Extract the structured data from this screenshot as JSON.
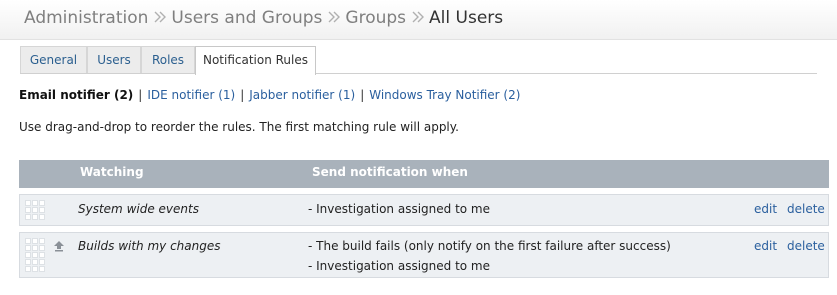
{
  "breadcrumb": {
    "items": [
      "Administration",
      "Users and Groups",
      "Groups"
    ],
    "current": "All Users"
  },
  "tabs": [
    {
      "label": "General",
      "active": false
    },
    {
      "label": "Users",
      "active": false
    },
    {
      "label": "Roles",
      "active": false
    },
    {
      "label": "Notification Rules",
      "active": true
    }
  ],
  "notifiers": {
    "current": "Email notifier (2)",
    "separator": "|",
    "links": [
      "IDE notifier (1)",
      "Jabber notifier (1)",
      "Windows Tray Notifier (2)"
    ]
  },
  "hint": "Use drag-and-drop to reorder the rules. The first matching rule will apply.",
  "table": {
    "headers": {
      "watching": "Watching",
      "send": "Send notification when"
    },
    "rows": [
      {
        "watching": "System wide events",
        "events": [
          "- Investigation assigned to me"
        ],
        "edit": "edit",
        "delete": "delete"
      },
      {
        "watching": "Builds with my changes",
        "events": [
          "- The build fails (only notify on the first failure after success)",
          "- Investigation assigned to me"
        ],
        "edit": "edit",
        "delete": "delete"
      }
    ]
  },
  "colors": {
    "link": "#2a5f9e",
    "header_bg": "#a9b2bb",
    "row_bg": "#edf0f3"
  },
  "icons": {
    "separator": "double-chevron-right-icon",
    "move": "move-up-icon",
    "drag": "drag-handle-icon"
  }
}
